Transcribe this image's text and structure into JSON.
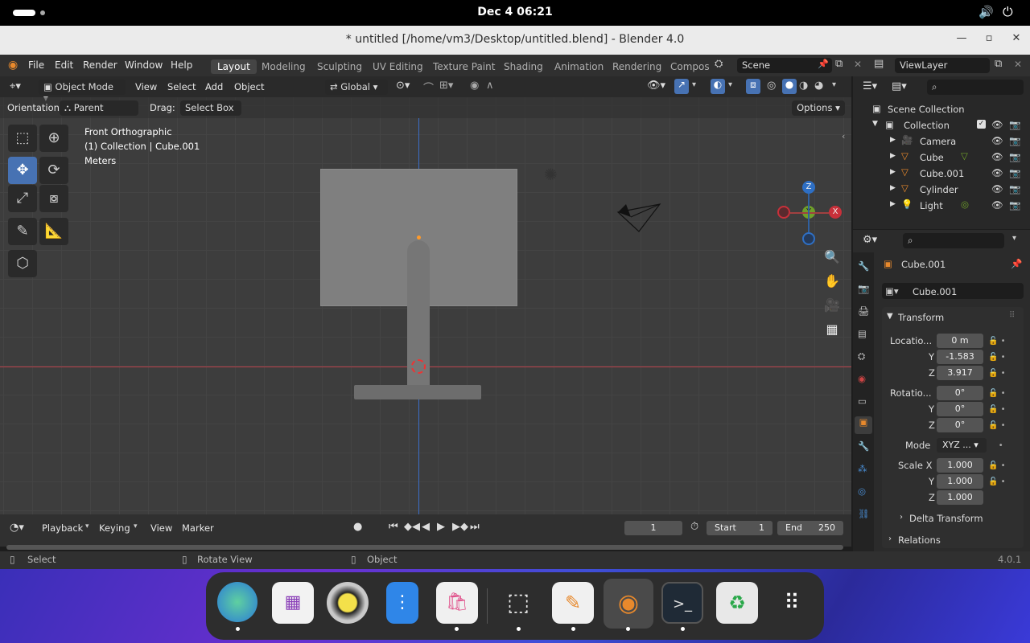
{
  "system": {
    "datetime": "Dec 4  06:21"
  },
  "window": {
    "title": "* untitled [/home/vm3/Desktop/untitled.blend] - Blender 4.0"
  },
  "menu": [
    "File",
    "Edit",
    "Render",
    "Window",
    "Help"
  ],
  "workspaces": [
    "Layout",
    "Modeling",
    "Sculpting",
    "UV Editing",
    "Texture Paint",
    "Shading",
    "Animation",
    "Rendering",
    "Compos"
  ],
  "active_workspace": "Layout",
  "scene": {
    "name": "Scene",
    "view_layer": "ViewLayer"
  },
  "viewport": {
    "mode": "Object Mode",
    "menus": [
      "View",
      "Select",
      "Add",
      "Object"
    ],
    "transform_orientation": "Global",
    "orientation_label": "Orientation:",
    "orientation_value": "Parent",
    "drag_label": "Drag:",
    "drag_value": "Select Box",
    "options_label": "Options",
    "overlay_text": {
      "view": "Front Orthographic",
      "collection": "(1) Collection | Cube.001",
      "units": "Meters"
    },
    "gizmo_axes": {
      "z": "Z",
      "y": "Y",
      "x": "X"
    }
  },
  "outliner": {
    "root": "Scene Collection",
    "collection": "Collection",
    "items": [
      "Camera",
      "Cube",
      "Cube.001",
      "Cylinder",
      "Light"
    ]
  },
  "properties": {
    "object_name": "Cube.001",
    "datablock_name": "Cube.001",
    "panel_transform": "Transform",
    "location_label": "Locatio...",
    "location": {
      "x": "0 m",
      "y": "-1.583",
      "z": "3.917"
    },
    "rotation_label": "Rotatio...",
    "rotation": {
      "x": "0°",
      "y": "0°",
      "z": "0°"
    },
    "mode_label": "Mode",
    "mode_value": "XYZ ...",
    "scale_label": "Scale X",
    "scale": {
      "x": "1.000",
      "y": "1.000",
      "z": "1.000"
    },
    "axis_y": "Y",
    "axis_z": "Z",
    "delta_transform": "Delta Transform",
    "relations": "Relations"
  },
  "timeline": {
    "menus": [
      "Playback",
      "Keying",
      "View",
      "Marker"
    ],
    "current_frame": "1",
    "start_label": "Start",
    "start_value": "1",
    "end_label": "End",
    "end_value": "250"
  },
  "statusbar": {
    "select": "Select",
    "rotate": "Rotate View",
    "object": "Object",
    "version": "4.0.1"
  },
  "colors": {
    "accent": "#4772b3",
    "x_axis": "#c8303a",
    "y_axis": "#6fa02a",
    "z_axis": "#2e6fc4",
    "orange": "#e8892c"
  }
}
